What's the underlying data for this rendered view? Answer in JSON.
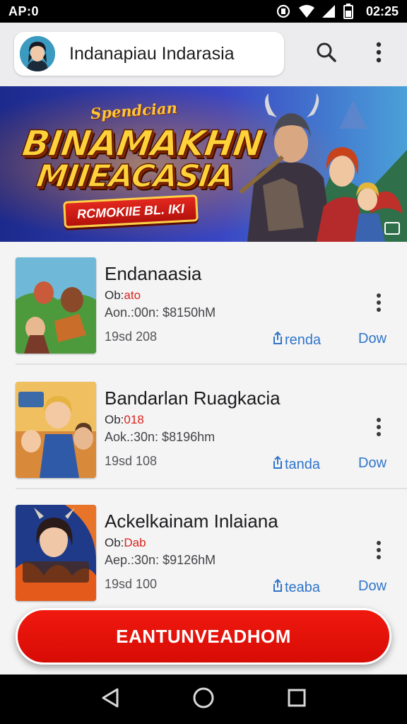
{
  "status_bar": {
    "carrier": "AP:0",
    "time": "02:25",
    "icons": [
      "notification-icon",
      "wifi-icon",
      "signal-icon",
      "battery-icon"
    ]
  },
  "search_bar": {
    "query": "Indanapiau Indarasia",
    "icons": [
      "avatar",
      "search-icon",
      "more-vert-icon"
    ]
  },
  "banner": {
    "subtitle": "Spendcian",
    "title_line1": "BINAMAKHN",
    "title_line2": "MIIEACASIA",
    "button_label": "RCMOKIIE BL. IKI"
  },
  "apps": [
    {
      "title": "Endanaasia",
      "line1_prefix": "Ob:",
      "line1_accent": "ato",
      "line2": "Aon.:00n: $8150hM",
      "line3": "19sd 208",
      "action_label": "renda",
      "download_label": "Dow"
    },
    {
      "title": "Bandarlan Ruagkacia",
      "line1_prefix": "Ob:",
      "line1_accent": "018",
      "line2": "Aok.:30n: $8196hm",
      "line3": "19sd 108",
      "action_label": "tanda",
      "download_label": "Dow"
    },
    {
      "title": "Ackelkainam Inlaiana",
      "line1_prefix": "Ob:",
      "line1_accent": "Dab",
      "line2": "Aep.:30n: $9126hM",
      "line3": "19sd 100",
      "action_label": "teaba",
      "download_label": "Dow"
    }
  ],
  "cta": {
    "label": "EANTUNVEADHOM"
  },
  "colors": {
    "accent_red": "#d70c05",
    "link_blue": "#2f75c9",
    "banner_gold": "#ffd23a"
  },
  "nav_bar": {
    "icons": [
      "back-icon",
      "home-icon",
      "recents-icon"
    ]
  }
}
